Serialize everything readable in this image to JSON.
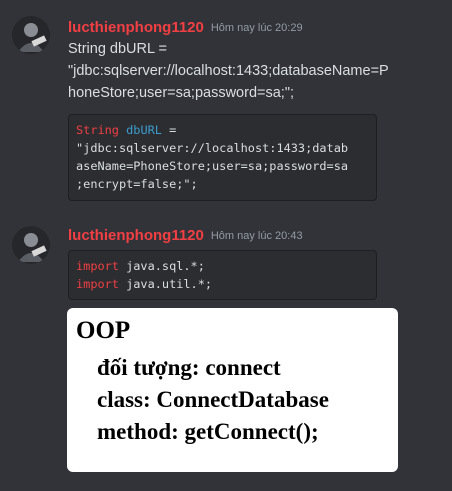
{
  "messages": [
    {
      "username": "lucthienphong1120",
      "timestamp": "Hôm nay lúc 20:29",
      "text_lines": [
        "String dbURL =",
        "\"jdbc:sqlserver://localhost:1433;databaseName=P",
        "honeStore;user=sa;password=sa;\";"
      ],
      "code": {
        "keyword": "String",
        "variable": "dbURL",
        "rest": " =\n\"jdbc:sqlserver://localhost:1433;datab\naseName=PhoneStore;user=sa;password=sa\n;encrypt=false;\";"
      }
    },
    {
      "username": "lucthienphong1120",
      "timestamp": "Hôm nay lúc 20:43",
      "code_lines": [
        {
          "keyword": "import",
          "rest": " java.sql.*;"
        },
        {
          "keyword": "import",
          "rest": " java.util.*;"
        }
      ],
      "image_text": {
        "title": "OOP",
        "lines": [
          "đối tượng: connect",
          "class: ConnectDatabase",
          "method: getConnect();"
        ]
      }
    }
  ],
  "colors": {
    "background": "#313338",
    "username": "#f23f43",
    "timestamp": "#949ba4",
    "keyword": "#f23f43",
    "variable": "#3c9ccf",
    "code_bg": "#2b2d31"
  },
  "icons": [
    "user-avatar-icon"
  ]
}
